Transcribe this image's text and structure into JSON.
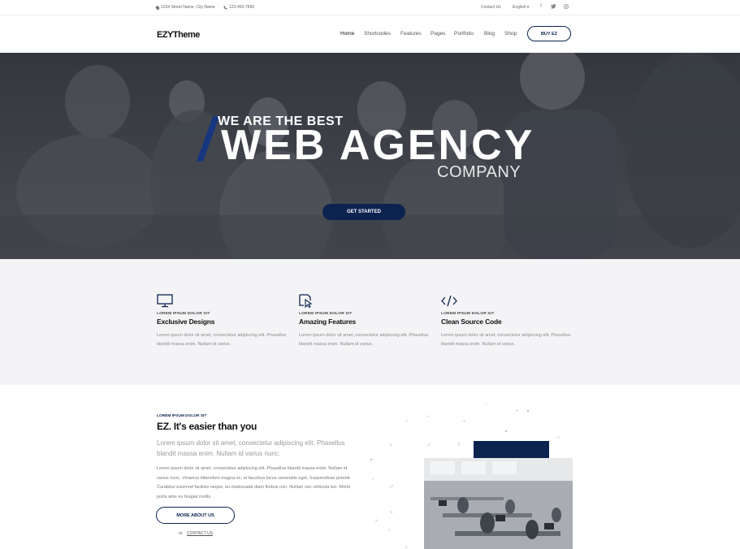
{
  "topbar": {
    "address": "1234 Street Name, City Name",
    "phone": "123-456-7890",
    "contact_link": "Contact Us",
    "language": "English",
    "language_caret": "▾",
    "social": {
      "facebook": "f",
      "twitter": "🐦",
      "instagram": "◎"
    }
  },
  "header": {
    "logo": "EZYTheme",
    "nav": [
      "Home",
      "Shortcodes",
      "Features",
      "Pages",
      "Portfolio",
      "Blog",
      "Shop"
    ],
    "active_nav": "Home",
    "buy_button": "BUY EZ"
  },
  "hero": {
    "subtitle": "WE ARE THE BEST",
    "title": "WEB AGENCY",
    "tagline": "COMPANY",
    "cta": "GET STARTED"
  },
  "features": [
    {
      "icon": "monitor-icon",
      "eyebrow": "LOREM IPSUM DOLOR SIT",
      "title": "Exclusive Designs",
      "text": "Lorem ipsum dolor sit amet, consectetur adipiscing elit. Phasellus blandit massa enim. Nullam id varius."
    },
    {
      "icon": "cursor-icon",
      "eyebrow": "LOREM IPSUM DOLOR SIT",
      "title": "Amazing Features",
      "text": "Lorem ipsum dolor sit amet, consectetur adipiscing elit. Phasellus blandit massa enim. Nullam id varius."
    },
    {
      "icon": "code-icon",
      "eyebrow": "LOREM IPSUM DOLOR SIT",
      "title": "Clean Source Code",
      "text": "Lorem ipsum dolor sit amet, consectetur adipiscing elit. Phasellus blandit massa enim. Nullam id varius."
    }
  ],
  "about": {
    "eyebrow": "LOREM IPSUM DOLOR SIT",
    "title": "EZ. It's easier than you",
    "lead": "Lorem ipsum dolor sit amet, consectetur adipiscing elit. Phasellus blandit massa enim. Nullam id varius nunc.",
    "body": "Lorem ipsum dolor sit amet, consectetur adipiscing elit. Phasellus blandit massa enim. Nullam id varius nunc. Vivamus bibendum magna ex, et faucibus lacus venenatis eget. Suspendisse potenti. Curabitur euismod facilisis neque, eu malesuada diam finibus non. Nullam nec vehicula leo. Morbi porta ante eu feugiat mollis.",
    "button": "MORE ABOUT US",
    "or": "or",
    "contact": "CONTACT US"
  },
  "colors": {
    "accent": "#0c2350",
    "hero_overlay": "#3a3d44",
    "features_bg": "#f4f4f6"
  }
}
